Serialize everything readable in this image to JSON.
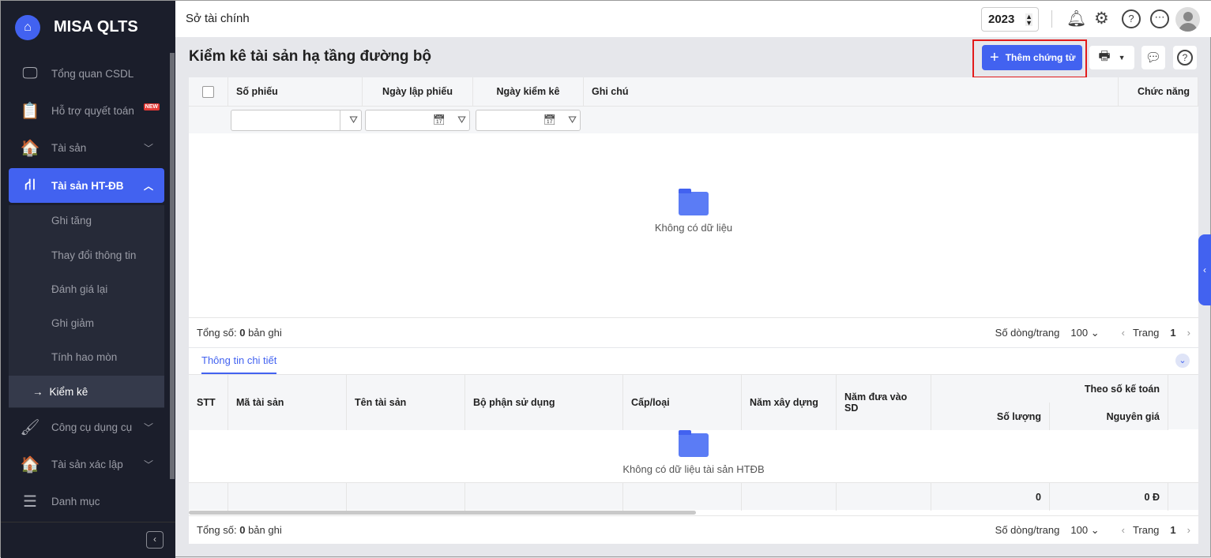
{
  "sidebar": {
    "brand": "MISA QLTS",
    "items": [
      {
        "label": "Tổng quan CSDL"
      },
      {
        "label": "Hỗ trợ quyết toán",
        "badge": "NEW"
      },
      {
        "label": "Tài sản"
      },
      {
        "label": "Tài sản HT-ĐB"
      },
      {
        "label": "Công cụ dụng cụ"
      },
      {
        "label": "Tài sản xác lập"
      },
      {
        "label": "Danh mục"
      }
    ],
    "subitems": [
      {
        "label": "Ghi tăng"
      },
      {
        "label": "Thay đổi thông tin"
      },
      {
        "label": "Đánh giá lại"
      },
      {
        "label": "Ghi giảm"
      },
      {
        "label": "Tính hao mòn"
      },
      {
        "label": "Kiểm kê"
      }
    ]
  },
  "header": {
    "title": "Sở tài chính",
    "year": "2023"
  },
  "page": {
    "title": "Kiểm kê tài sản hạ tầng đường bộ",
    "add_label": "Thêm chứng từ"
  },
  "grid1": {
    "columns": [
      "Số phiếu",
      "Ngày lập phiếu",
      "Ngày kiểm kê",
      "Ghi chú",
      "Chức năng"
    ],
    "empty": "Không có dữ liệu",
    "footer": {
      "total_prefix": "Tổng số:",
      "total": "0",
      "total_suffix": "bản ghi",
      "rows_label": "Số dòng/trang",
      "rows_value": "100",
      "page_label": "Trang",
      "page": "1"
    }
  },
  "detail": {
    "tab": "Thông tin chi tiết",
    "columns": [
      "STT",
      "Mã tài sản",
      "Tên tài sản",
      "Bộ phận sử dụng",
      "Cấp/loại",
      "Năm xây dựng",
      "Năm đưa vào SD"
    ],
    "group": "Theo số kế toán",
    "sub_columns": [
      "Số lượng",
      "Nguyên giá"
    ],
    "empty": "Không có dữ liệu tài sản HTĐB",
    "sum_quantity": "0",
    "sum_cost": "0 Đ",
    "footer": {
      "total_prefix": "Tổng số:",
      "total": "0",
      "total_suffix": "bản ghi",
      "rows_label": "Số dòng/trang",
      "rows_value": "100",
      "page_label": "Trang",
      "page": "1"
    }
  }
}
